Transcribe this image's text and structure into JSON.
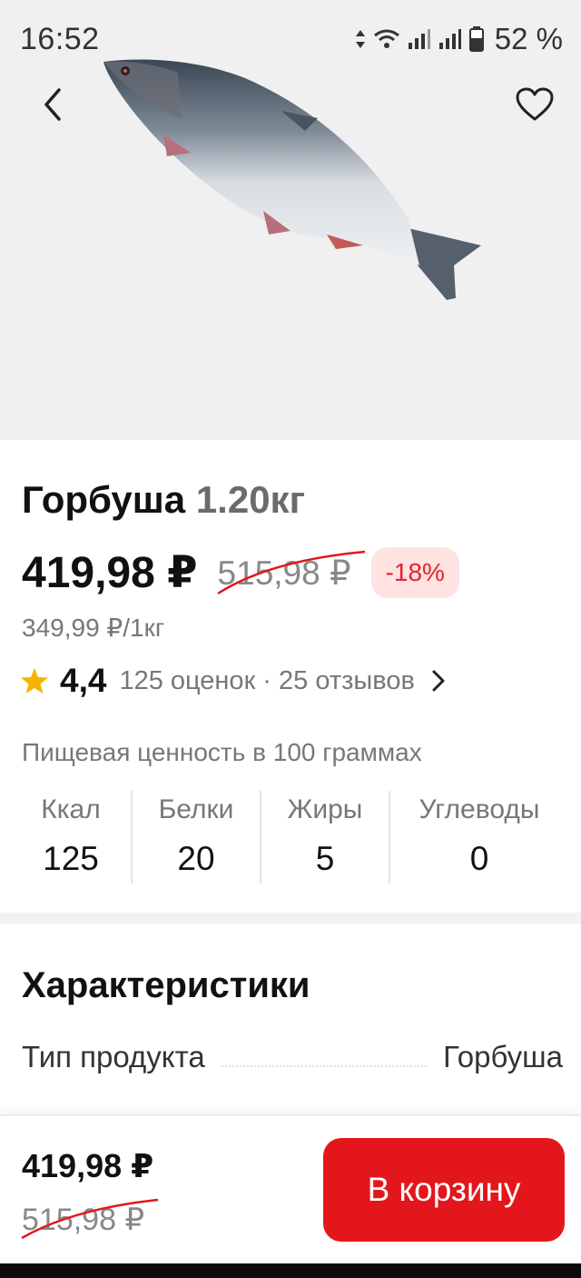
{
  "status_bar": {
    "time": "16:52",
    "battery": "52 %"
  },
  "product": {
    "name": "Горбуша",
    "weight": "1.20кг",
    "price": "419,98 ₽",
    "old_price": "515,98 ₽",
    "discount": "-18%",
    "unit_price": "349,99 ₽/1кг",
    "rating": "4,4",
    "reviews": "125 оценок · 25 отзывов"
  },
  "nutrition": {
    "title": "Пищевая ценность в 100 граммах",
    "items": [
      {
        "label": "Ккал",
        "value": "125"
      },
      {
        "label": "Белки",
        "value": "20"
      },
      {
        "label": "Жиры",
        "value": "5"
      },
      {
        "label": "Углеводы",
        "value": "0"
      }
    ]
  },
  "specs": {
    "title": "Характеристики",
    "rows": [
      {
        "key": "Тип продукта",
        "value": "Горбуша"
      }
    ]
  },
  "bottom_bar": {
    "price": "419,98 ₽",
    "old_price": "515,98 ₽",
    "cart_label": "В корзину"
  },
  "colors": {
    "accent": "#e3171b",
    "discount_bg": "#ffe2e2",
    "star": "#f5b400"
  }
}
